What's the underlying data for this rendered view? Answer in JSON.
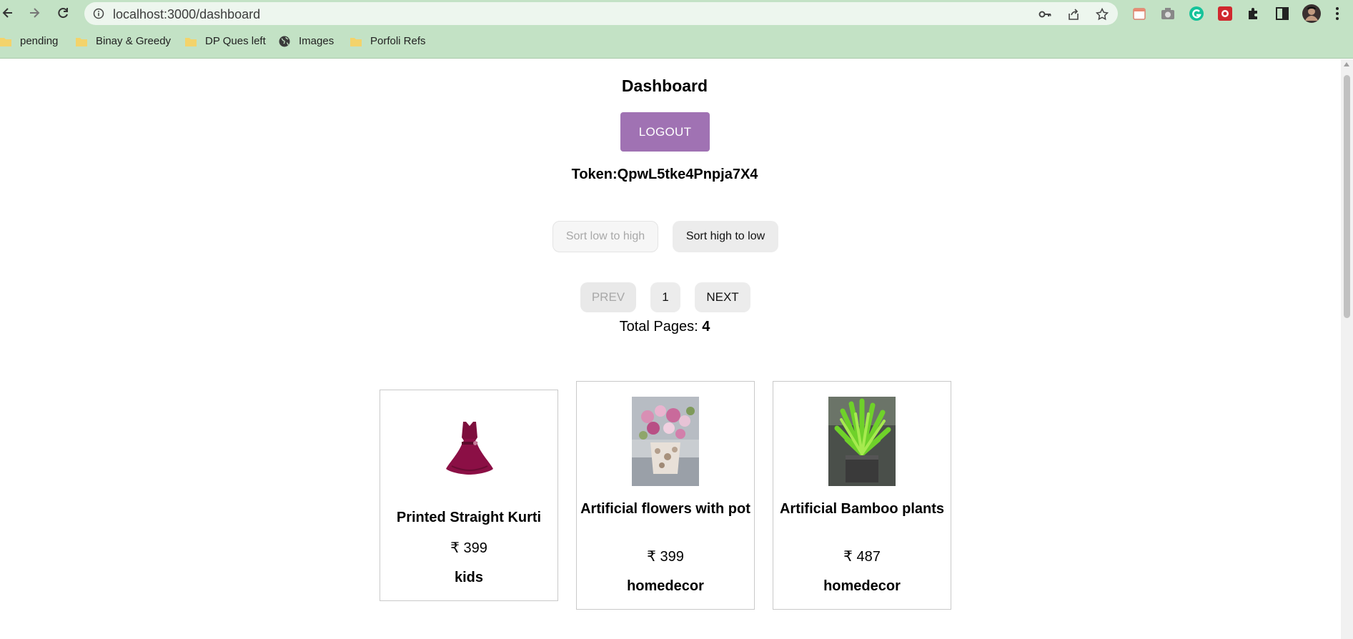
{
  "browser": {
    "url": "localhost:3000/dashboard",
    "bookmarks": [
      {
        "label": "pending",
        "icon": "folder-icon"
      },
      {
        "label": "Binay & Greedy",
        "icon": "folder-icon"
      },
      {
        "label": "DP Ques left",
        "icon": "folder-icon"
      },
      {
        "label": "Images",
        "icon": "globe-icon"
      },
      {
        "label": "Porfoli Refs",
        "icon": "folder-icon"
      }
    ]
  },
  "dashboard": {
    "title": "Dashboard",
    "logout_label": "LOGOUT",
    "token_label": "Token:QpwL5tke4Pnpja7X4",
    "sort_low_label": "Sort low to high",
    "sort_high_label": "Sort high to low",
    "pagination": {
      "prev_label": "PREV",
      "current_page": "1",
      "next_label": "NEXT",
      "total_label": "Total Pages: ",
      "total_pages": "4"
    },
    "products": [
      {
        "name": "Printed Straight Kurti",
        "price": "₹ 399",
        "category": "kids",
        "image": "dress-image"
      },
      {
        "name": "Artificial flowers with pot",
        "price": "₹ 399",
        "category": "homedecor",
        "image": "flowers-image"
      },
      {
        "name": "Artificial Bamboo plants",
        "price": "₹ 487",
        "category": "homedecor",
        "image": "bamboo-image"
      }
    ]
  },
  "colors": {
    "chrome": "#c3e2c5",
    "logout_button": "#a072b3"
  }
}
